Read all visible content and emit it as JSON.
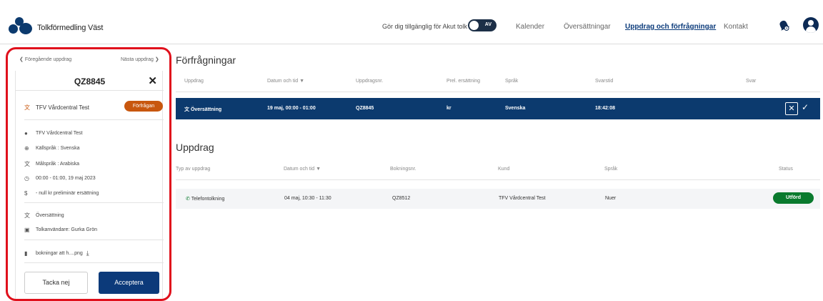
{
  "header": {
    "brand": "Tolkförmedling Väst",
    "akut_label": "Gör dig tillgänglig för Akut tolk",
    "toggle_text": "AV",
    "nav": [
      "Kalender",
      "Översättningar",
      "Uppdrag och förfrågningar",
      "Kontakt"
    ],
    "icons": {
      "bell": "bell-icon",
      "user": "user-avatar-icon"
    }
  },
  "sidebar": {
    "prev": "Föregående uppdrag",
    "next": "Nästa uppdrag",
    "id": "QZ8845",
    "customer": "TFV Vårdcentral Test",
    "badge": "Förfrågan",
    "details": {
      "person": "TFV Vårdcentral Test",
      "source": "Källspråk : Svenska",
      "target": "Målspråk : Arabiska",
      "time": "00:00 - 01:00, 19 maj 2023",
      "fee": "- null kr preliminär ersättning",
      "type": "Översättning",
      "user": "Tolkanvändare: Gurka Grön",
      "file": "bokningar att h....png"
    },
    "decline": "Tacka nej",
    "accept": "Acceptera"
  },
  "requests": {
    "title": "Förfrågningar",
    "headers": [
      "Uppdrag",
      "Datum och tid",
      "Uppdragsnr.",
      "Prel. ersättning",
      "Språk",
      "Svarstid",
      "Svar"
    ],
    "row": {
      "type": "Översättning",
      "datetime": "19 maj, 00:00 - 01:00",
      "nr": "QZ8845",
      "fee": "kr",
      "lang": "Svenska",
      "time": "18:42:08"
    }
  },
  "jobs": {
    "title": "Uppdrag",
    "headers": [
      "Typ av uppdrag",
      "Datum och tid",
      "Bokningsnr.",
      "Kund",
      "Språk",
      "Status"
    ],
    "row": {
      "type": "Telefontolkning",
      "datetime": "04 maj, 10:30 - 11:30",
      "nr": "QZ8512",
      "customer": "TFV Vårdcentral Test",
      "lang": "Nuer",
      "status": "Utförd"
    }
  },
  "colors": {
    "primary": "#0c3a6e",
    "accent": "#c8570e",
    "success": "#0a7a2e",
    "highlight": "#e0101c"
  }
}
